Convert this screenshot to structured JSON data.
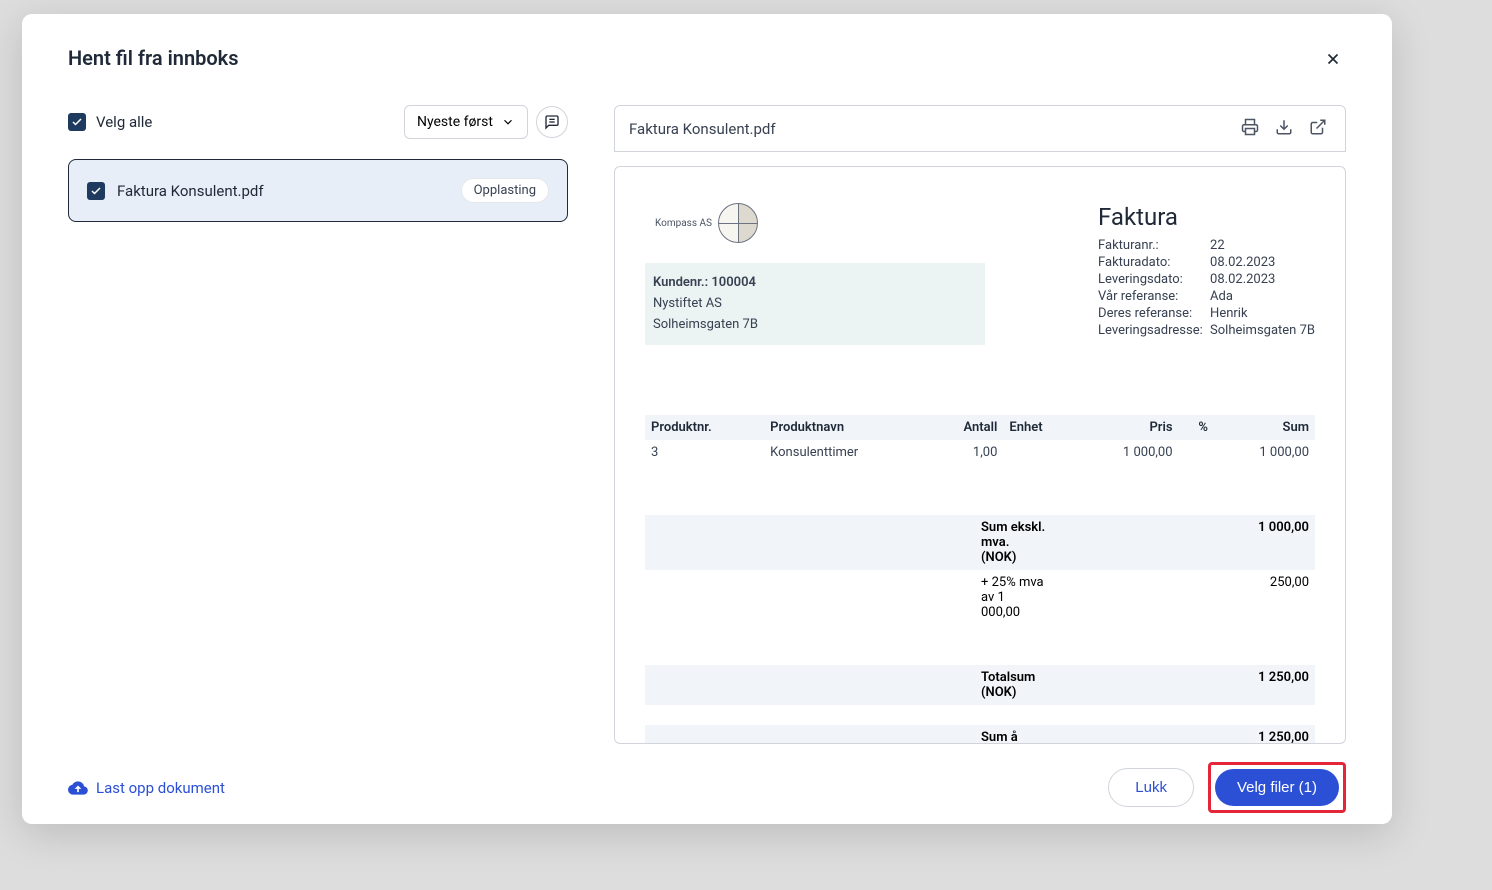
{
  "modal": {
    "title": "Hent fil fra innboks",
    "selectAllLabel": "Velg alle",
    "sortLabel": "Nyeste først",
    "file": {
      "name": "Faktura Konsulent.pdf",
      "badge": "Opplasting"
    },
    "previewFilename": "Faktura Konsulent.pdf",
    "uploadLabel": "Last opp dokument",
    "closeLabel": "Lukk",
    "selectLabel": "Velg filer (1)"
  },
  "invoice": {
    "companyName": "Kompass AS",
    "title": "Faktura",
    "meta": {
      "fakturanrLabel": "Fakturanr.:",
      "fakturanr": "22",
      "fakturadatoLabel": "Fakturadato:",
      "fakturadato": "08.02.2023",
      "leveringsdatoLabel": "Leveringsdato:",
      "leveringsdato": "08.02.2023",
      "varRefLabel": "Vår referanse:",
      "varRef": "Ada",
      "deresRefLabel": "Deres referanse:",
      "deresRef": "Henrik",
      "levAdrLabel": "Leveringsadresse:",
      "levAdr": "Solheimsgaten 7B"
    },
    "customer": {
      "kundenr": "Kundenr.: 100004",
      "navn": "Nystiftet AS",
      "adresse": "Solheimsgaten 7B"
    },
    "headers": {
      "produktnr": "Produktnr.",
      "produktnavn": "Produktnavn",
      "antall": "Antall",
      "enhet": "Enhet",
      "pris": "Pris",
      "pct": "%",
      "sum": "Sum"
    },
    "line": {
      "produktnr": "3",
      "produktnavn": "Konsulenttimer",
      "antall": "1,00",
      "enhet": "",
      "pris": "1 000,00",
      "pct": "",
      "sum": "1 000,00"
    },
    "totals": {
      "eksLabel": "Sum ekskl. mva. (NOK)",
      "eks": "1 000,00",
      "mvaLabel": "+ 25% mva av 1 000,00",
      "mva": "250,00",
      "totalLabel": "Totalsum (NOK)",
      "total": "1 250,00",
      "betaleLabel": "Sum å betale (NOK)",
      "betale": "1 250,00"
    }
  }
}
